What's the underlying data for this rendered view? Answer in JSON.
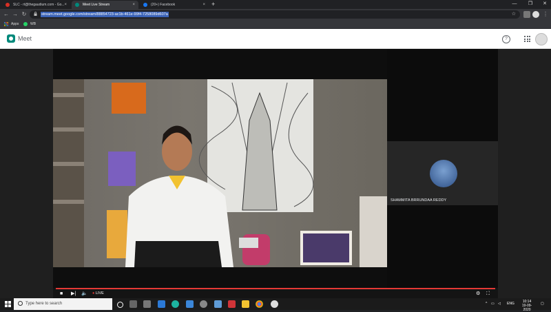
{
  "browser": {
    "tabs": [
      {
        "title": "SLC - rt@thegaudium.com - Go...",
        "favicon": "gmail-icon",
        "close": "×",
        "active": false
      },
      {
        "title": "Meet Live Stream",
        "favicon": "meet-icon",
        "close": "×",
        "active": true
      },
      {
        "title": "(20+) Facebook",
        "favicon": "facebook-icon",
        "close": "×",
        "active": false
      }
    ],
    "new_tab": "+",
    "url": "stream.meet.google.com/stream/88854723-ac1b-461e-99f4-7258089d607a",
    "bookmarks": [
      {
        "label": "Apps",
        "icon": "apps-grid-icon"
      },
      {
        "label": "WB",
        "icon": "whatsapp-icon"
      }
    ]
  },
  "meet": {
    "title": "Meet",
    "participant_name": "SHAMMITA BRRUNDAA REDDY",
    "live_label": "LIVE",
    "live_dot": "●"
  },
  "taskbar": {
    "search_placeholder": "Type here to search",
    "language": "ENG",
    "time": "10:14",
    "date": "19-09-2020"
  },
  "colors": {
    "accent_live": "#e53935",
    "meet_brand": "#00897b",
    "url_highlight": "#3b63b7"
  }
}
